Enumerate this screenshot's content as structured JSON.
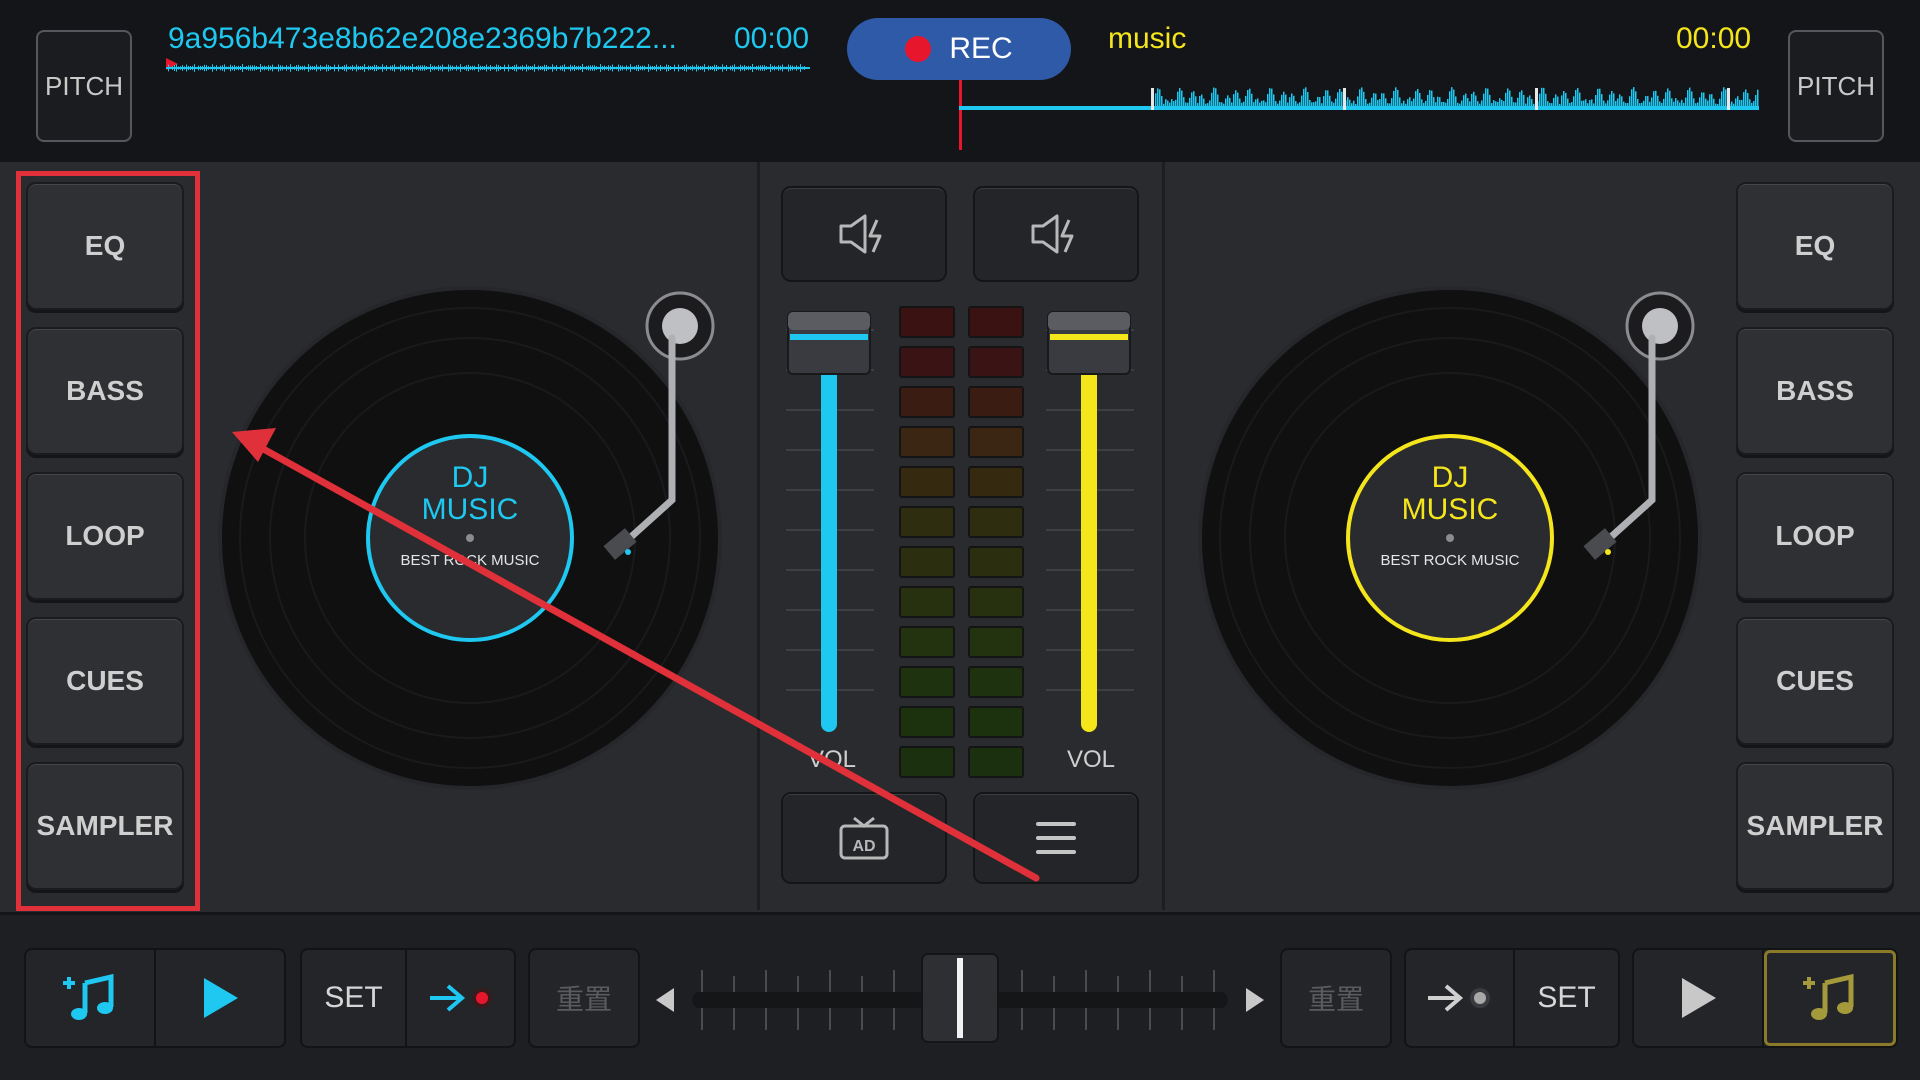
{
  "colors": {
    "deck_a": "#1ec8f0",
    "deck_b": "#f5e61c",
    "rec": "#e8162d",
    "annotation": "#e0313a"
  },
  "header": {
    "pitch_left": "PITCH",
    "pitch_right": "PITCH",
    "deck_a_title": "9a956b473e8b62e208e2369b7b222...",
    "deck_a_time": "00:00",
    "rec_label": "REC",
    "deck_b_title": "music",
    "deck_b_time": "00:00"
  },
  "left_panel": {
    "items": [
      {
        "label": "EQ"
      },
      {
        "label": "BASS"
      },
      {
        "label": "LOOP"
      },
      {
        "label": "CUES"
      },
      {
        "label": "SAMPLER"
      }
    ]
  },
  "right_panel": {
    "items": [
      {
        "label": "EQ"
      },
      {
        "label": "BASS"
      },
      {
        "label": "LOOP"
      },
      {
        "label": "CUES"
      },
      {
        "label": "SAMPLER"
      }
    ]
  },
  "deck_a": {
    "label_line1": "DJ",
    "label_line2": "MUSIC",
    "label_sub": "BEST ROCK MUSIC"
  },
  "deck_b": {
    "label_line1": "DJ",
    "label_line2": "MUSIC",
    "label_sub": "BEST ROCK MUSIC"
  },
  "mixer": {
    "vol_left_label": "VOL",
    "vol_right_label": "VOL",
    "ad_label": "AD",
    "icons": [
      "speaker-boost-icon",
      "speaker-boost-icon",
      "tv-ad-icon",
      "menu-icon"
    ]
  },
  "footer": {
    "set_left": "SET",
    "reset_left": "重置",
    "reset_right": "重置",
    "set_right": "SET"
  }
}
